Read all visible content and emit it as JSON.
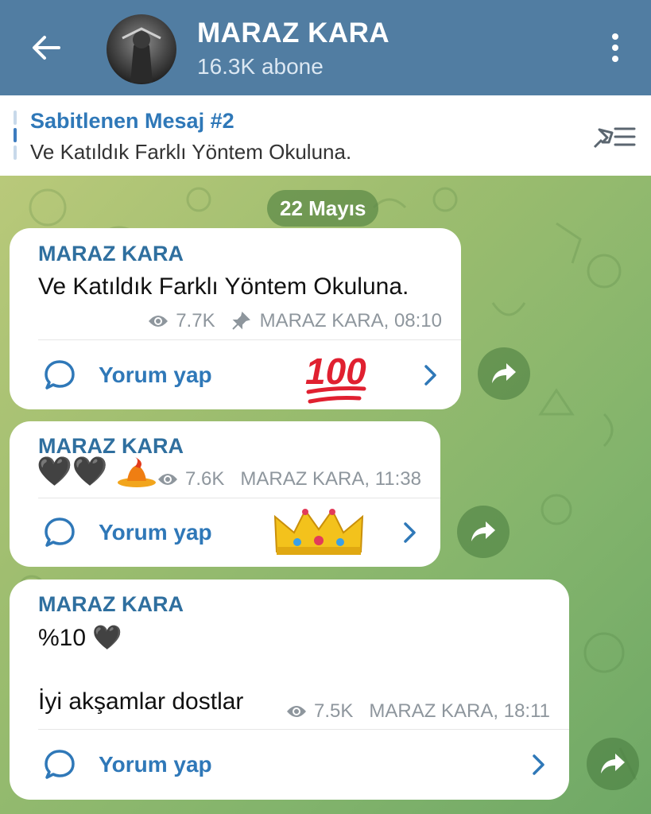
{
  "header": {
    "title": "MARAZ KARA",
    "subtitle": "16.3K abone"
  },
  "pinned": {
    "title": "Sabitlenen Mesaj #2",
    "text": "Ve Katıldık Farklı Yöntem Okuluna."
  },
  "date_label": "22 Mayıs",
  "messages": [
    {
      "sender": "MARAZ KARA",
      "text": "Ve Katıldık Farklı Yöntem Okuluna.",
      "views": "7.7K",
      "meta": "MARAZ KARA, 08:10",
      "comment_label": "Yorum yap",
      "reaction_text": "100"
    },
    {
      "sender": "MARAZ KARA",
      "text": "🖤🖤",
      "views": "7.6K",
      "meta": "MARAZ KARA, 11:38",
      "comment_label": "Yorum yap"
    },
    {
      "sender": "MARAZ KARA",
      "line1": "%10 🖤",
      "line2": "İyi akşamlar dostlar",
      "views": "7.5K",
      "meta": "MARAZ KARA, 18:11",
      "comment_label": "Yorum yap"
    }
  ],
  "icons": {
    "back": "arrow-left-icon",
    "menu": "more-vertical-icon",
    "pin_list": "pin-list-icon",
    "views": "eye-icon",
    "pinned_marker": "pin-icon",
    "comment": "comment-bubble-icon",
    "chevron": "chevron-right-icon",
    "share": "share-arrow-icon"
  },
  "colors": {
    "header": "#517da2",
    "accent": "#2f78b8",
    "sender": "#2f6f9f"
  }
}
